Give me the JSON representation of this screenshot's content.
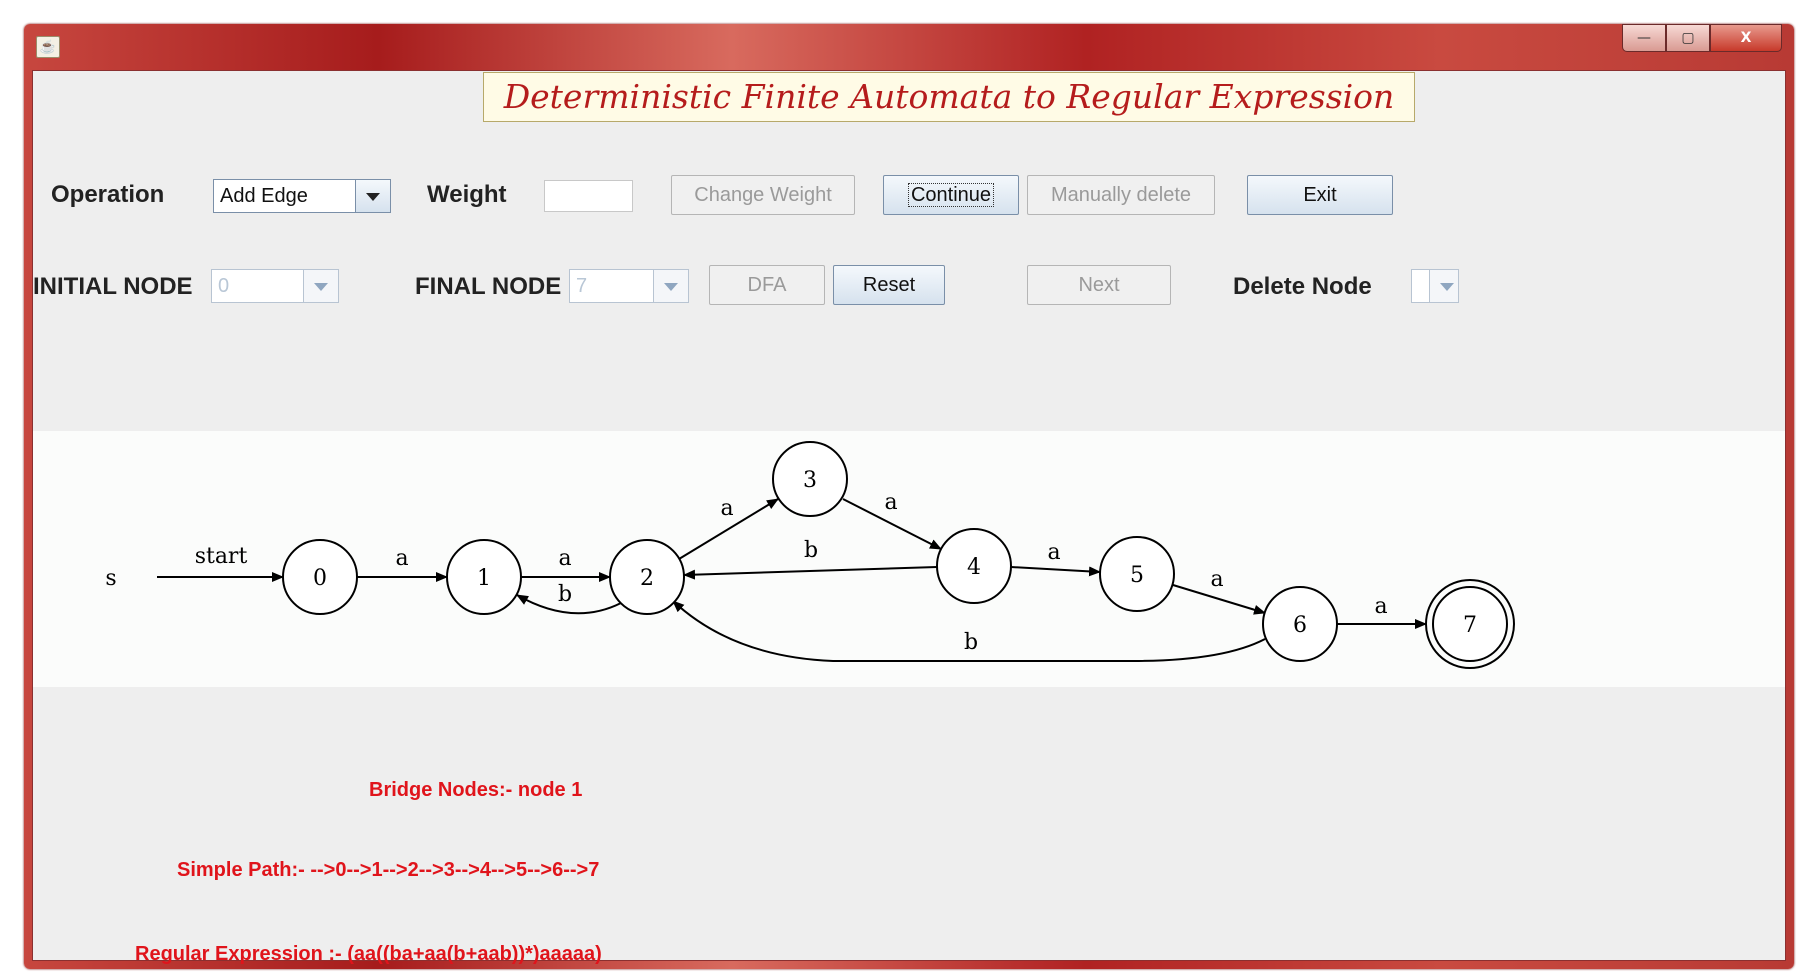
{
  "window": {
    "icon": "java-cup-icon",
    "controls": {
      "minimize": "—",
      "maximize": "▢",
      "close": "X"
    }
  },
  "title": "Deterministic Finite Automata to Regular Expression",
  "row1": {
    "operation_label": "Operation",
    "operation_value": "Add Edge",
    "weight_label": "Weight",
    "weight_value": "",
    "change_weight": "Change Weight",
    "continue": "Continue",
    "manually_delete": "Manually delete",
    "exit": "Exit"
  },
  "row2": {
    "initial_node_label": "INITIAL NODE",
    "initial_node_value": "0",
    "final_node_label": "FINAL NODE",
    "final_node_value": "7",
    "dfa": "DFA",
    "reset": "Reset",
    "next": "Next",
    "delete_node_label": "Delete Node",
    "delete_node_value": ""
  },
  "graph": {
    "start_node_label": "s",
    "nodes": [
      "0",
      "1",
      "2",
      "3",
      "4",
      "5",
      "6",
      "7"
    ],
    "accepting_nodes": [
      "7"
    ],
    "edges": [
      {
        "from": "s",
        "to": "0",
        "label": "start"
      },
      {
        "from": "0",
        "to": "1",
        "label": "a"
      },
      {
        "from": "1",
        "to": "2",
        "label": "a"
      },
      {
        "from": "2",
        "to": "1",
        "label": "b"
      },
      {
        "from": "2",
        "to": "3",
        "label": "a"
      },
      {
        "from": "3",
        "to": "4",
        "label": "a"
      },
      {
        "from": "4",
        "to": "2",
        "label": "b"
      },
      {
        "from": "4",
        "to": "5",
        "label": "a"
      },
      {
        "from": "5",
        "to": "6",
        "label": "a"
      },
      {
        "from": "6",
        "to": "7",
        "label": "a"
      },
      {
        "from": "6",
        "to": "2",
        "label": "b"
      }
    ]
  },
  "results": {
    "bridge_nodes": "Bridge Nodes:-  node 1",
    "simple_path": "Simple Path:- -->0-->1-->2-->3-->4-->5-->6-->7",
    "regular_expression": "Regular Expression :- (aa((ba+aa(b+aab))*)aaaaa)"
  },
  "colors": {
    "result_text": "#e0141b",
    "title_text": "#b51c1c",
    "frame": "#b02222"
  }
}
